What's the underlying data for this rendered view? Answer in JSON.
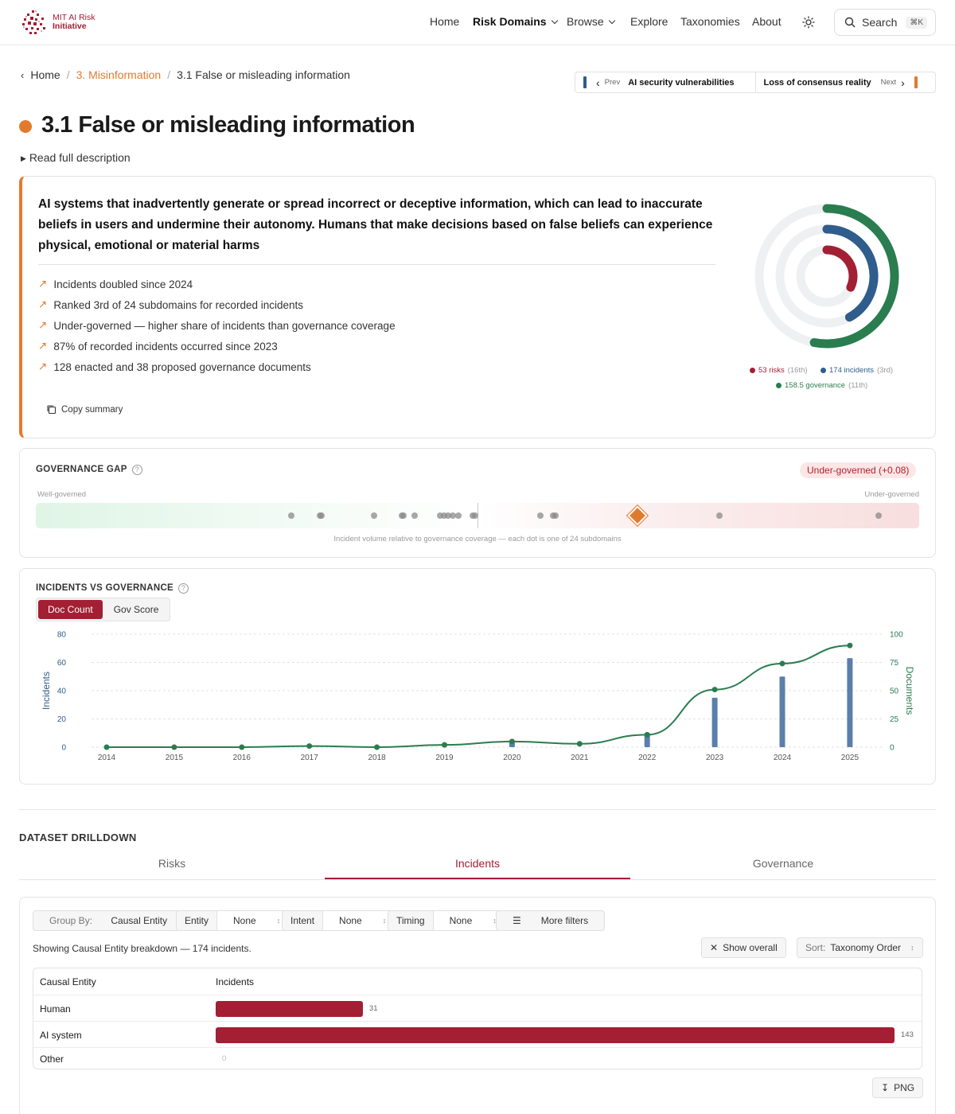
{
  "header": {
    "logo_line1": "MIT AI Risk",
    "logo_line2": "Initiative",
    "nav": [
      "Home",
      "Risk Domains",
      "Browse",
      "Explore",
      "Taxonomies",
      "About"
    ],
    "search_label": "Search",
    "search_shortcut": "⌘K"
  },
  "breadcrumb": {
    "home": "Home",
    "parent": "3. Misinformation",
    "current": "3.1 False or misleading information"
  },
  "prevnext": {
    "prev_label": "Prev",
    "prev_title": "AI security vulnerabilities",
    "next_title": "Loss of consensus reality",
    "next_label": "Next",
    "prev_color": "#2f5d8c",
    "next_color": "#e07b2e"
  },
  "page": {
    "title": "3.1 False or misleading information",
    "read_full": "Read full description",
    "accent": "#e07b2e"
  },
  "summary": {
    "text": "AI systems that inadvertently generate or spread incorrect or deceptive information, which can lead to inaccurate beliefs in users and undermine their autonomy. Humans that make decisions based on false beliefs can experience physical, emotional or material harms",
    "bullets": [
      "Incidents doubled since 2024",
      "Ranked 3rd of 24 subdomains for recorded incidents",
      "Under-governed — higher share of incidents than governance coverage",
      "87% of recorded incidents occurred since 2023",
      "128 enacted and 38 proposed governance documents"
    ],
    "copy_label": "Copy summary",
    "rings": [
      {
        "label": "53 risks",
        "rank": "(16th)",
        "color": "#a31f34",
        "fraction": 0.32
      },
      {
        "label": "174 incidents",
        "rank": "(3rd)",
        "color": "#2f5d8c",
        "fraction": 0.42
      },
      {
        "label": "158.5 governance",
        "rank": "(11th)",
        "color": "#2a7d4f",
        "fraction": 0.53
      }
    ]
  },
  "governance_gap": {
    "title": "GOVERNANCE GAP",
    "badge": "Under-governed (+0.08)",
    "left_label": "Well-governed",
    "right_label": "Under-governed",
    "caption": "Incident volume relative to governance coverage — each dot is one of 24 subdomains",
    "dots": [
      0.289,
      0.322,
      0.323,
      0.383,
      0.414,
      0.416,
      0.429,
      0.458,
      0.462,
      0.467,
      0.472,
      0.478,
      0.495,
      0.497,
      0.571,
      0.586,
      0.588,
      0.774,
      0.954
    ],
    "current": 0.681
  },
  "chart": {
    "title": "INCIDENTS VS GOVERNANCE",
    "toggle_on": "Doc Count",
    "toggle_off": "Gov Score"
  },
  "chart_data": {
    "type": "bar",
    "categories": [
      "2014",
      "2015",
      "2016",
      "2017",
      "2018",
      "2019",
      "2020",
      "2021",
      "2022",
      "2023",
      "2024",
      "2025"
    ],
    "series": [
      {
        "name": "Incidents",
        "type": "bar",
        "axis": "left",
        "color": "#5b7fab",
        "values": [
          0,
          0,
          0,
          0,
          0,
          0,
          4,
          0,
          10,
          35,
          50,
          63
        ]
      },
      {
        "name": "Documents",
        "type": "line",
        "axis": "right",
        "color": "#2a7d4f",
        "values": [
          0,
          0,
          0,
          1,
          0,
          2,
          5,
          3,
          11,
          51,
          74,
          90
        ]
      }
    ],
    "ylabel": "Incidents",
    "y2label": "Documents",
    "ylim": [
      0,
      80
    ],
    "y2lim": [
      0,
      100
    ],
    "yticks": [
      "0",
      "20",
      "40",
      "60",
      "80"
    ],
    "y2ticks": [
      "0",
      "25",
      "50",
      "75",
      "100"
    ],
    "grid": true
  },
  "drilldown": {
    "title": "DATASET DRILLDOWN",
    "tabs": [
      "Risks",
      "Incidents",
      "Governance"
    ],
    "group_by_label": "Group By:",
    "group_by_value": "Causal Entity",
    "filters": [
      {
        "label": "Entity",
        "value": "None"
      },
      {
        "label": "Intent",
        "value": "None"
      },
      {
        "label": "Timing",
        "value": "None"
      }
    ],
    "more_filters": "More filters",
    "showing": "Showing Causal Entity breakdown — 174 incidents.",
    "show_overall": "Show overall",
    "sort_label": "Sort:",
    "sort_value": "Taxonomy Order",
    "col1": "Causal Entity",
    "col2": "Incidents",
    "rows": [
      {
        "name": "Human",
        "value": 31
      },
      {
        "name": "AI system",
        "value": 143
      },
      {
        "name": "Other",
        "value": 0
      }
    ],
    "png": "PNG"
  }
}
